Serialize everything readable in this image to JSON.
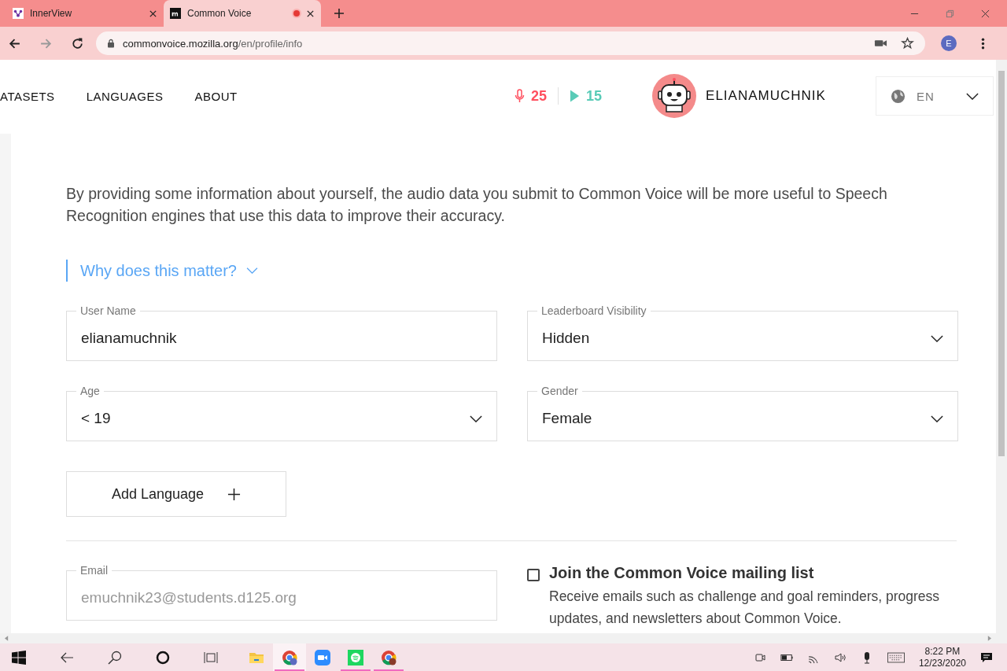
{
  "browser": {
    "tabs": [
      {
        "title": "InnerView",
        "kind": "innerview",
        "selected": false,
        "recording": false
      },
      {
        "title": "Common Voice",
        "kind": "mozilla",
        "selected": true,
        "recording": true
      }
    ],
    "address": {
      "host": "commonvoice.mozilla.org",
      "path": "/en/profile/info"
    },
    "profile_initial": "E"
  },
  "nav": {
    "items": [
      "ATASETS",
      "LANGUAGES",
      "ABOUT"
    ],
    "recorded": "25",
    "validated": "15",
    "username": "ELIANAMUCHNIK",
    "language": "EN"
  },
  "intro": "By providing some information about yourself, the audio data you submit to Common Voice will be more useful to Speech Recognition engines that use this data to improve their accuracy.",
  "why_link": "Why does this matter?",
  "fields": [
    {
      "label": "User Name",
      "value": "elianamuchnik",
      "kind": "text"
    },
    {
      "label": "Leaderboard Visibility",
      "value": "Hidden",
      "kind": "select"
    },
    {
      "label": "Age",
      "value": "< 19",
      "kind": "select"
    },
    {
      "label": "Gender",
      "value": "Female",
      "kind": "select"
    }
  ],
  "add_language": "Add Language",
  "email": {
    "label": "Email",
    "value": "emuchnik23@students.d125.org",
    "disabled": true
  },
  "mailing": {
    "checked": false,
    "title": "Join the Common Voice mailing list",
    "description": "Receive emails such as challenge and goal reminders, progress updates, and newsletters about Common Voice."
  },
  "taskbar": {
    "apps": [
      {
        "kind": "explorer",
        "running": false,
        "selected": false
      },
      {
        "kind": "chrome-profile",
        "running": true,
        "selected": true
      },
      {
        "kind": "zoom",
        "running": false,
        "selected": false
      },
      {
        "kind": "spotify",
        "running": true,
        "selected": false
      },
      {
        "kind": "chrome-avatar",
        "running": true,
        "selected": false
      }
    ],
    "time": "8:22 PM",
    "date": "12/23/2020"
  }
}
